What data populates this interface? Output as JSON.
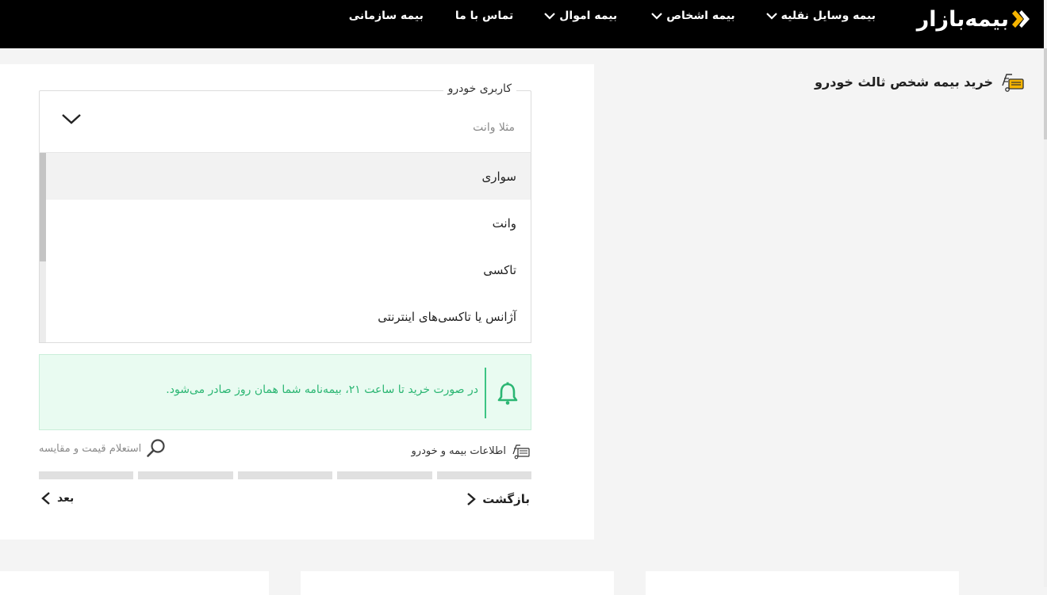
{
  "header": {
    "logo_text": "بیمه‌بازار",
    "nav": [
      {
        "label": "بیمه وسایل نقلیه",
        "has_dropdown": true
      },
      {
        "label": "بیمه اشخاص",
        "has_dropdown": true
      },
      {
        "label": "بیمه اموال",
        "has_dropdown": true
      },
      {
        "label": "تماس با ما",
        "has_dropdown": false
      },
      {
        "label": "بیمه سازمانی",
        "has_dropdown": false
      }
    ]
  },
  "page": {
    "heading": "خرید بیمه شخص ثالث خودرو"
  },
  "form": {
    "select_label": "کاربری خودرو",
    "select_placeholder": "مثلا وانت",
    "options": [
      "سواری",
      "وانت",
      "تاکسی",
      "آژانس یا تاکسی‌های اینترنتی"
    ]
  },
  "notice": {
    "text": "در صورت خرید تا ساعت ۲۱، بیمه‌نامه شما همان روز صادر می‌شود."
  },
  "steps": {
    "current": "اطلاعات بیمه و خودرو",
    "quote": "استعلام قیمت و مقایسه",
    "segments": 5
  },
  "buttons": {
    "back": "بازگشت",
    "next": "بعد"
  },
  "colors": {
    "accent": "#f5b400",
    "notice_green": "#2bb673",
    "notice_bg": "#e9fbf1",
    "header_bg": "#000000"
  }
}
